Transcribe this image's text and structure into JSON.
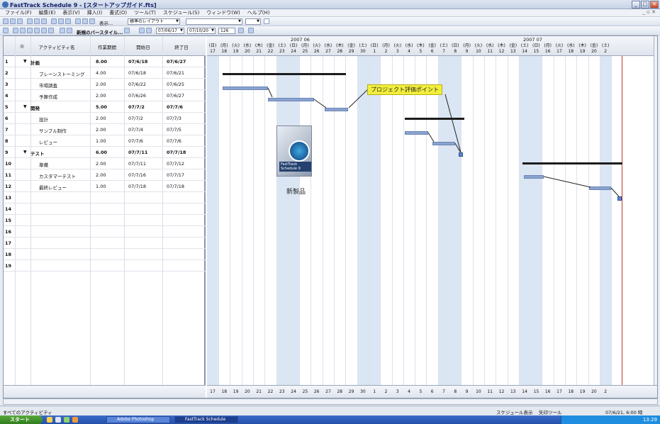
{
  "window": {
    "title": "FastTrack Schedule 9 - [スタートアップガイド.fts]"
  },
  "menu": [
    "ファイル(F)",
    "編集(E)",
    "表示(V)",
    "挿入(I)",
    "書式(O)",
    "ツール(T)",
    "スケジュール(S)",
    "ウィンドウ(W)",
    "ヘルプ(H)"
  ],
  "toolbar": {
    "view_label": "表示...",
    "layout_combo": "標準のレイアウト",
    "style_combo": "新規のバースタイル...",
    "date_start": "07/06/17",
    "date_end": "07/10/20",
    "zoom": "126"
  },
  "columns": {
    "name": "アクティビティ名",
    "work": "作業期間",
    "start": "開始日",
    "end": "終了日"
  },
  "rows": [
    {
      "n": "1",
      "name": "計画",
      "work": "8.00",
      "start": "07/6/18",
      "end": "07/6/27",
      "summary": true
    },
    {
      "n": "2",
      "name": "ブレーンストーミング",
      "work": "4.00",
      "start": "07/6/18",
      "end": "07/6/21",
      "summary": false
    },
    {
      "n": "3",
      "name": "市場調査",
      "work": "2.00",
      "start": "07/6/22",
      "end": "07/6/25",
      "summary": false
    },
    {
      "n": "4",
      "name": "予算作成",
      "work": "2.00",
      "start": "07/6/26",
      "end": "07/6/27",
      "summary": false
    },
    {
      "n": "5",
      "name": "開発",
      "work": "5.00",
      "start": "07/7/2",
      "end": "07/7/6",
      "summary": true
    },
    {
      "n": "6",
      "name": "設計",
      "work": "2.00",
      "start": "07/7/2",
      "end": "07/7/3",
      "summary": false
    },
    {
      "n": "7",
      "name": "サンプル制作",
      "work": "2.00",
      "start": "07/7/4",
      "end": "07/7/5",
      "summary": false
    },
    {
      "n": "8",
      "name": "レビュー",
      "work": "1.00",
      "start": "07/7/6",
      "end": "07/7/6",
      "summary": false
    },
    {
      "n": "9",
      "name": "テスト",
      "work": "6.00",
      "start": "07/7/11",
      "end": "07/7/18",
      "summary": true
    },
    {
      "n": "10",
      "name": "準備",
      "work": "2.00",
      "start": "07/7/11",
      "end": "07/7/12",
      "summary": false
    },
    {
      "n": "11",
      "name": "カスタマーテスト",
      "work": "2.00",
      "start": "07/7/16",
      "end": "07/7/17",
      "summary": false
    },
    {
      "n": "12",
      "name": "最終レビュー",
      "work": "1.00",
      "start": "07/7/18",
      "end": "07/7/18",
      "summary": false
    },
    {
      "n": "13"
    },
    {
      "n": "14"
    },
    {
      "n": "15"
    },
    {
      "n": "16"
    },
    {
      "n": "17"
    },
    {
      "n": "18"
    },
    {
      "n": "19"
    }
  ],
  "timeline": {
    "month1": "2007 06",
    "month2": "2007 07",
    "dows": [
      "(日)",
      "(月)",
      "(火)",
      "(水)",
      "(木)",
      "(金)",
      "(土)",
      "(日)",
      "(月)",
      "(火)",
      "(水)",
      "(木)",
      "(金)",
      "(土)",
      "(日)",
      "(月)",
      "(火)",
      "(水)",
      "(木)",
      "(金)",
      "(土)",
      "(日)",
      "(月)",
      "(火)",
      "(水)",
      "(木)",
      "(金)",
      "(土)",
      "(日)",
      "(月)",
      "(火)",
      "(水)",
      "(木)",
      "(金)",
      "(土)",
      "(日)",
      "(月)",
      "(火)",
      "(水)"
    ],
    "days": [
      "17",
      "18",
      "19",
      "20",
      "21",
      "22",
      "23",
      "24",
      "25",
      "26",
      "27",
      "28",
      "29",
      "30",
      "1",
      "2",
      "3",
      "4",
      "5",
      "6",
      "7",
      "8",
      "9",
      "10",
      "11",
      "12",
      "13",
      "14",
      "15",
      "16",
      "17",
      "18",
      "19",
      "20",
      "2"
    ]
  },
  "annotations": {
    "callout": "プロジェクト評価ポイント",
    "product_caption": "新製品",
    "product_box_label": "FastTrack Schedule 9"
  },
  "status": {
    "left": "すべてのアクティビティ",
    "mode": "スケジュール表示",
    "tool": "矢印ツール",
    "datetime": "07/6/21, 6:00 時"
  },
  "taskbar": {
    "start": "スタート",
    "task1": "Adobe Photoshop",
    "task2": "FastTrack Schedule",
    "clock": "13:29"
  }
}
